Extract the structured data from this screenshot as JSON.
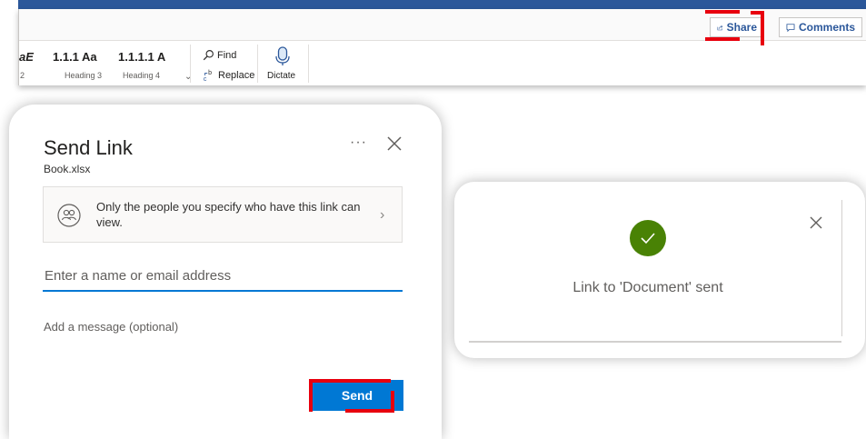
{
  "ribbon": {
    "share_label": "Share",
    "comments_label": "Comments",
    "styles": [
      {
        "sample": "aE",
        "name": "2"
      },
      {
        "sample": "1.1.1 Aa",
        "name": "Heading 3"
      },
      {
        "sample": "1.1.1.1 A",
        "name": "Heading 4"
      }
    ],
    "find_label": "Find",
    "replace_label": "Replace",
    "dictate_label": "Dictate"
  },
  "send_link": {
    "title": "Send Link",
    "file_name": "Book.xlsx",
    "permission_text": "Only the people you specify who have this link can view.",
    "recipient_placeholder": "Enter a name or email address",
    "message_placeholder": "Add a message (optional)",
    "send_label": "Send"
  },
  "confirmation": {
    "message": "Link to 'Document' sent"
  },
  "colors": {
    "brand_blue": "#2b579a",
    "accent_blue": "#0078d4",
    "success_green": "#498205",
    "highlight_red": "#e8000e"
  }
}
